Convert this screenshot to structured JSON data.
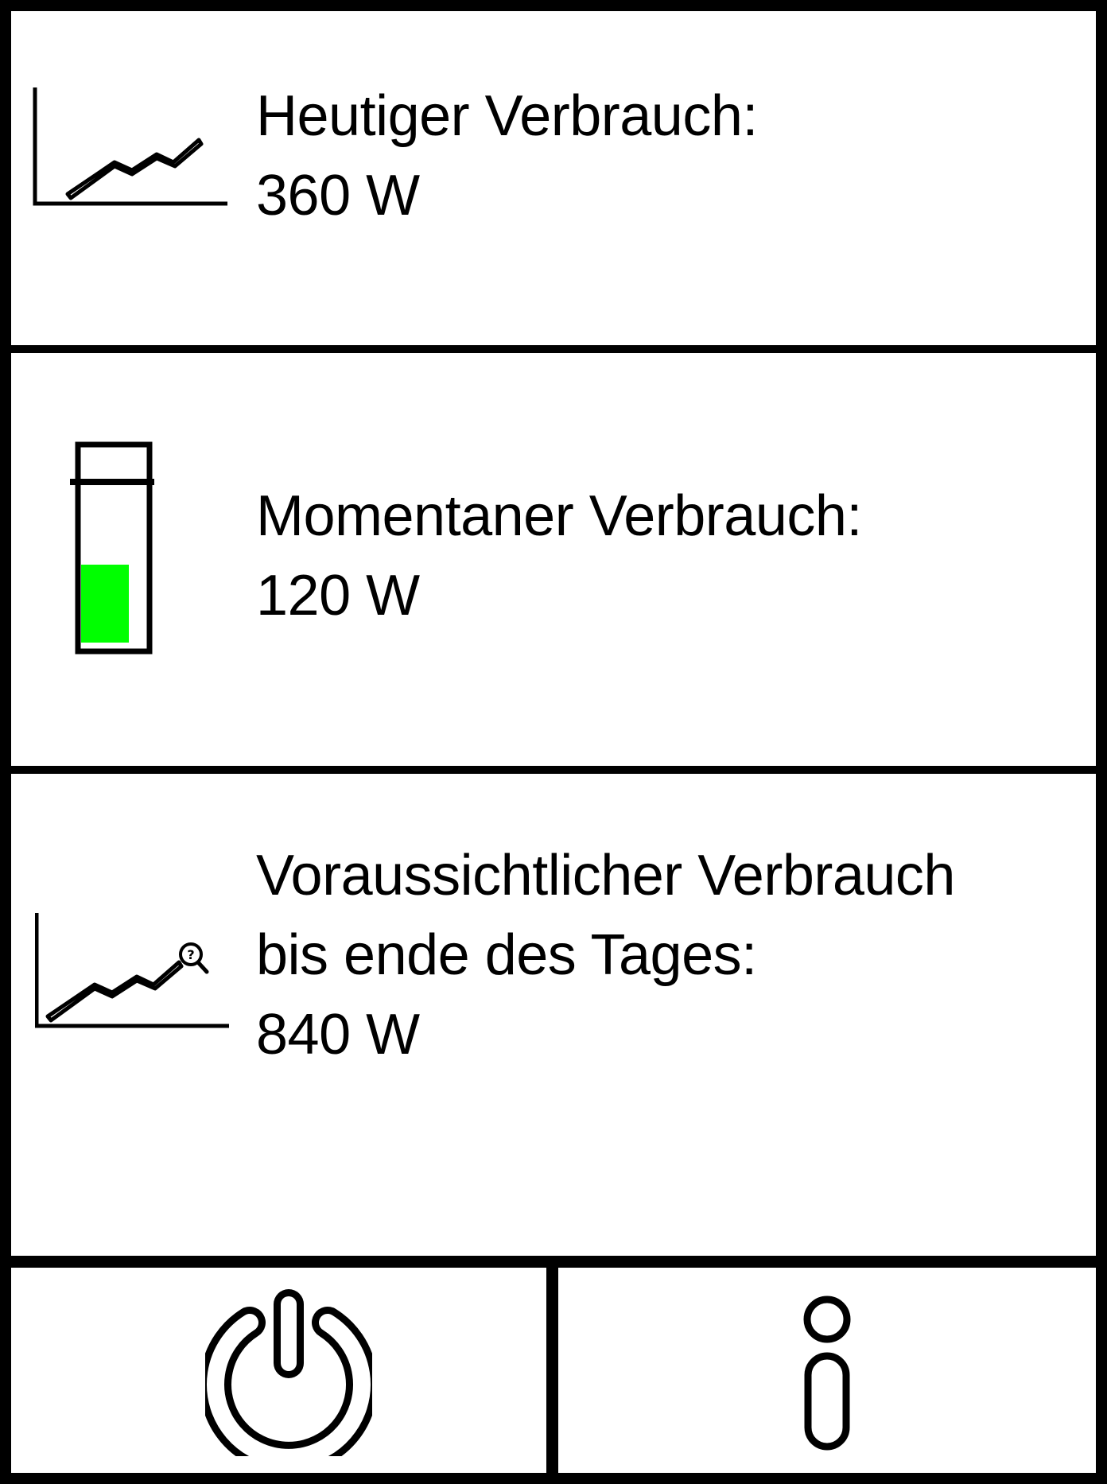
{
  "panels": {
    "today": {
      "label": "Heutiger Verbrauch:",
      "value": "360 W",
      "icon": "line-chart-icon"
    },
    "current": {
      "label": "Momentaner Verbrauch:",
      "value": "120 W",
      "icon": "battery-level-icon",
      "level_fraction": 0.5
    },
    "forecast": {
      "label_line1": "Voraussichtlicher Verbrauch",
      "label_line2": "bis ende des Tages:",
      "value": "840 W",
      "icon": "forecast-chart-icon"
    }
  },
  "buttons": {
    "power": {
      "icon": "power-icon"
    },
    "info": {
      "icon": "info-icon"
    }
  },
  "colors": {
    "border": "#000000",
    "background": "#ffffff",
    "battery_fill": "#00ff00"
  }
}
